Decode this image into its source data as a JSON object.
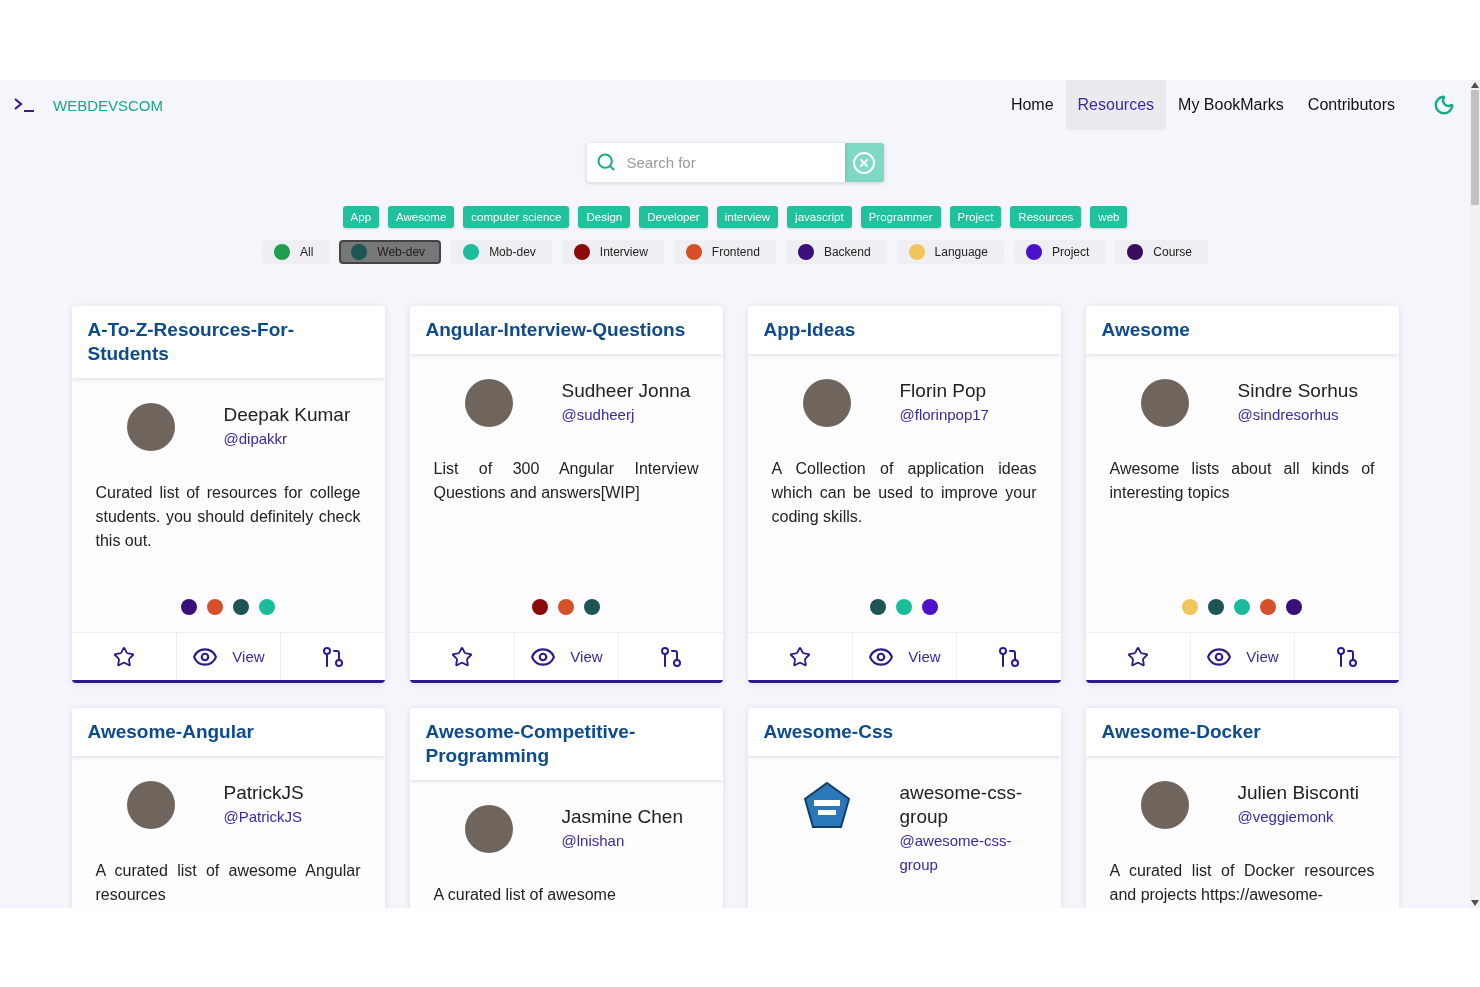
{
  "navbar": {
    "brand": "WEBDEVSCOM",
    "links": [
      {
        "label": "Home",
        "selected": false
      },
      {
        "label": "Resources",
        "selected": true
      },
      {
        "label": "My BookMarks",
        "selected": false
      },
      {
        "label": "Contributors",
        "selected": false
      }
    ]
  },
  "search": {
    "placeholder": "Search for"
  },
  "tags": [
    "App",
    "Awesome",
    "computer science",
    "Design",
    "Developer",
    "interview",
    "javascript",
    "Programmer",
    "Project",
    "Resources",
    "web"
  ],
  "categories": [
    {
      "label": "All",
      "color": "#1d9e4f",
      "selected": false
    },
    {
      "label": "Web-dev",
      "color": "#1e5454",
      "selected": true
    },
    {
      "label": "Mob-dev",
      "color": "#1abc9c",
      "selected": false
    },
    {
      "label": "Interview",
      "color": "#8b0a0a",
      "selected": false
    },
    {
      "label": "Frontend",
      "color": "#d4512a",
      "selected": false
    },
    {
      "label": "Backend",
      "color": "#3a0f7a",
      "selected": false
    },
    {
      "label": "Language",
      "color": "#f2c55c",
      "selected": false
    },
    {
      "label": "Project",
      "color": "#4b12c9",
      "selected": false
    },
    {
      "label": "Course",
      "color": "#3b0c5c",
      "selected": false
    }
  ],
  "cards": [
    {
      "title": "A-To-Z-Resources-For-Students",
      "author": {
        "kind": "photo",
        "name": "Deepak Kumar",
        "handle": "@dipakkr"
      },
      "description": "Curated list of resources for college students. you should definitely check this out.",
      "dots": [
        {
          "color": "#3a0f7a"
        },
        {
          "color": "#d4512a"
        },
        {
          "color": "#1e5454"
        },
        {
          "color": "#1abc9c"
        }
      ],
      "footer": {
        "bookmarked": false,
        "view_label": "View"
      }
    },
    {
      "title": "Angular-Interview-Questions",
      "author": {
        "kind": "photo",
        "name": "Sudheer Jonna",
        "handle": "@sudheerj"
      },
      "description": "List of 300 Angular Interview Questions and answers[WIP]",
      "dots": [
        {
          "color": "#8b0a0a"
        },
        {
          "color": "#d4512a"
        },
        {
          "color": "#1e5454"
        }
      ],
      "footer": {
        "bookmarked": false,
        "view_label": "View"
      }
    },
    {
      "title": "App-Ideas",
      "author": {
        "kind": "photo",
        "name": "Florin Pop",
        "handle": "@florinpop17"
      },
      "description": "A Collection of application ideas which can be used to improve your coding skills.",
      "dots": [
        {
          "color": "#1e5454"
        },
        {
          "color": "#1abc9c"
        },
        {
          "color": "#4b12c9"
        }
      ],
      "footer": {
        "bookmarked": false,
        "view_label": "View"
      }
    },
    {
      "title": "Awesome",
      "author": {
        "kind": "photo",
        "name": "Sindre Sorhus",
        "handle": "@sindresorhus"
      },
      "description": "Awesome lists about all kinds of interesting topics",
      "dots": [
        {
          "color": "#f2c55c"
        },
        {
          "color": "#1e5454"
        },
        {
          "color": "#1abc9c"
        },
        {
          "color": "#d4512a"
        },
        {
          "color": "#3a0f7a"
        }
      ],
      "footer": {
        "bookmarked": false,
        "view_label": "View"
      }
    },
    {
      "title": "Awesome-Angular",
      "author": {
        "kind": "photo",
        "name": "PatrickJS",
        "handle": "@PatrickJS"
      },
      "description": "A curated list of awesome Angular resources"
    },
    {
      "title": "Awesome-Competitive-Programming",
      "author": {
        "kind": "photo",
        "name": "Jasmine Chen",
        "handle": "@lnishan"
      },
      "description": "A curated list of awesome"
    },
    {
      "title": "Awesome-Css",
      "author": {
        "kind": "logo",
        "name": "awesome-css-group",
        "handle": "@awesome-css-group"
      }
    },
    {
      "title": "Awesome-Docker",
      "author": {
        "kind": "photo",
        "name": "Julien Bisconti",
        "handle": "@veggiemonk"
      },
      "description": "A curated list of Docker resources and projects https://awesome-"
    }
  ]
}
